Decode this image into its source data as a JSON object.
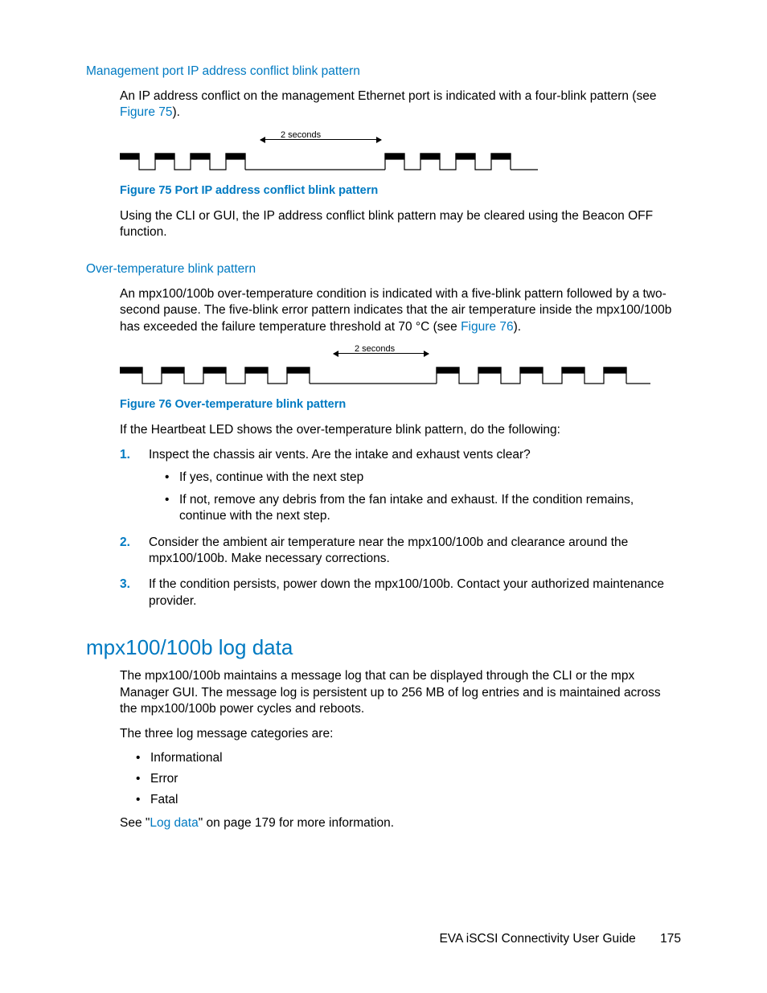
{
  "section1": {
    "heading": "Management port IP address conflict blink pattern",
    "p1a": "An IP address conflict on the management Ethernet port is indicated with a four-blink pattern (see ",
    "p1link": "Figure 75",
    "p1b": ").",
    "fig_caption": "Figure 75 Port IP address conflict blink pattern",
    "p2": "Using the CLI or GUI, the IP address conflict blink pattern may be cleared using the Beacon OFF function."
  },
  "section2": {
    "heading": "Over-temperature blink pattern",
    "p1a": "An mpx100/100b over-temperature condition is indicated with a five-blink pattern followed by a two-second pause. The five-blink error pattern indicates that the air temperature inside the mpx100/100b has exceeded the failure temperature threshold at 70 °C (see ",
    "p1link": "Figure 76",
    "p1b": ").",
    "fig_caption": "Figure 76 Over-temperature blink pattern",
    "p2": "If the Heartbeat LED shows the over-temperature blink pattern, do the following:",
    "steps": {
      "s1": "Inspect the chassis air vents. Are the intake and exhaust vents clear?",
      "s1a": "If yes, continue with the next step",
      "s1b": "If not, remove any debris from the fan intake and exhaust. If the condition remains, continue with the next step.",
      "s2": "Consider the ambient air temperature near the mpx100/100b and clearance around the mpx100/100b. Make necessary corrections.",
      "s3": "If the condition persists, power down the mpx100/100b. Contact your authorized maintenance provider."
    }
  },
  "section3": {
    "heading": "mpx100/100b log data",
    "p1": "The mpx100/100b maintains a message log that can be displayed through the CLI or the mpx Manager GUI. The message log is persistent up to 256 MB of log entries and is maintained across the mpx100/100b power cycles and reboots.",
    "p2": "The three log message categories are:",
    "items": {
      "i1": "Informational",
      "i2": "Error",
      "i3": "Fatal"
    },
    "p3a": "See \"",
    "p3link": "Log data",
    "p3b": "\" on page 179 for more information."
  },
  "chart_data": [
    {
      "type": "timing-diagram",
      "title": "Figure 75 Port IP address conflict blink pattern",
      "pulses_per_group": 4,
      "gap_label": "2 seconds",
      "groups_shown": 2
    },
    {
      "type": "timing-diagram",
      "title": "Figure 76 Over-temperature blink pattern",
      "pulses_per_group": 5,
      "gap_label": "2 seconds",
      "groups_shown": 2
    }
  ],
  "footer": {
    "title": "EVA iSCSI Connectivity User Guide",
    "page": "175"
  }
}
